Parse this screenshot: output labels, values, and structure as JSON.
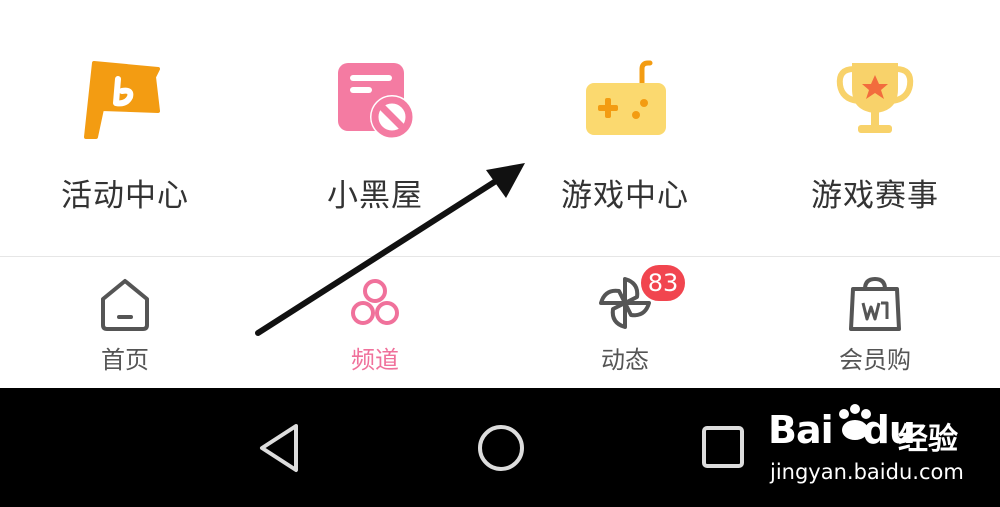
{
  "channels": [
    {
      "label": "活动中心",
      "icon": "activity-flag-icon"
    },
    {
      "label": "小黑屋",
      "icon": "blocked-calendar-icon"
    },
    {
      "label": "游戏中心",
      "icon": "gamepad-icon"
    },
    {
      "label": "游戏赛事",
      "icon": "trophy-icon"
    }
  ],
  "tabs": [
    {
      "label": "首页",
      "icon": "home-icon",
      "active": false
    },
    {
      "label": "频道",
      "icon": "channels-icon",
      "active": true
    },
    {
      "label": "动态",
      "icon": "pinwheel-icon",
      "active": false,
      "badge": "83"
    },
    {
      "label": "会员购",
      "icon": "shopping-bag-icon",
      "active": false
    }
  ],
  "navbar": {
    "back_icon": "back-triangle-icon",
    "home_icon": "home-circle-icon",
    "recents_icon": "recents-square-icon"
  },
  "watermark": {
    "brand": "Bai",
    "brand_suffix": "du",
    "product": "经验",
    "url": "jingyan.baidu.com"
  },
  "colors": {
    "accent_pink": "#f0719b",
    "badge_red": "#f1454f",
    "flag_orange": "#f39c12",
    "gamepad_yellow": "#fbd96f",
    "trophy_yellow": "#f8d26a"
  }
}
